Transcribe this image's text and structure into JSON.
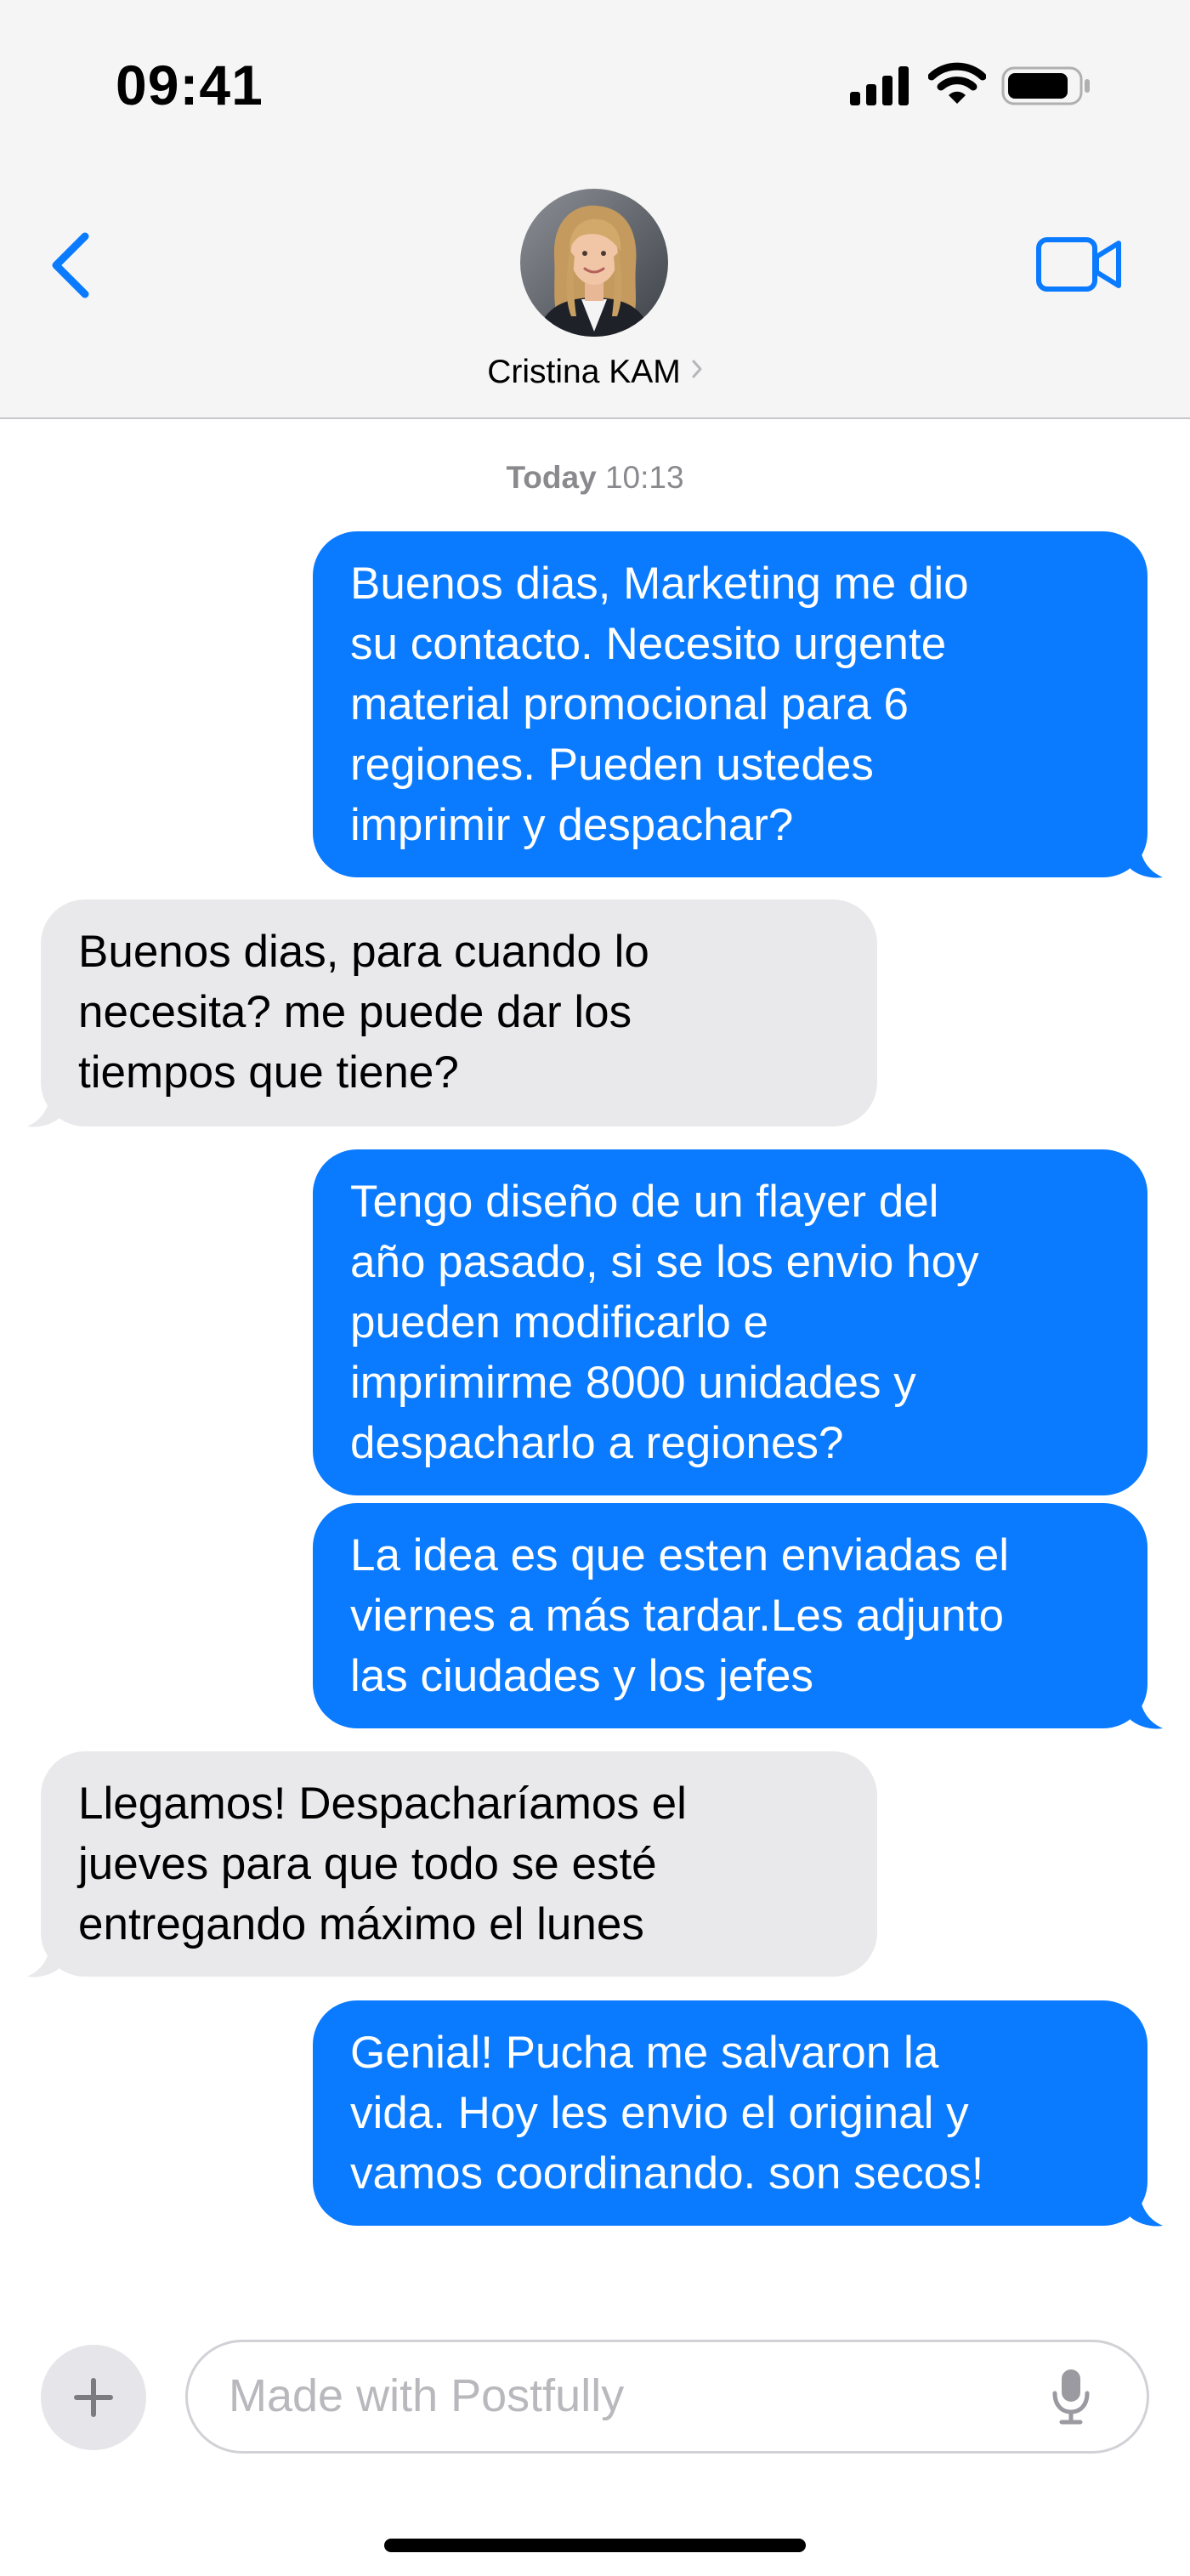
{
  "status_bar": {
    "time": "09:41"
  },
  "header": {
    "contact_name": "Cristina KAM",
    "avatar_icon": "contact-avatar-photo",
    "back_icon": "chevron-left-icon",
    "video_icon": "video-camera-icon"
  },
  "conversation": {
    "timestamp_day": "Today",
    "timestamp_time": "10:13",
    "messages": [
      {
        "direction": "outgoing",
        "text": "Buenos dias, Marketing me dio\nsu contacto. Necesito urgente\nmaterial promocional para 6\nregiones. Pueden ustedes\nimprimir y despachar?"
      },
      {
        "direction": "incoming",
        "text": "Buenos dias, para cuando lo\nnecesita? me puede dar los\ntiempos que tiene?"
      },
      {
        "direction": "outgoing",
        "text": "Tengo  diseño de un flayer del\naño pasado, si se los envio hoy\npueden modificarlo e\nimprimirme 8000 unidades y\ndespacharlo a regiones?"
      },
      {
        "direction": "outgoing",
        "text": "La idea es que esten enviadas el\nviernes a más tardar.Les adjunto\nlas ciudades y los jefes"
      },
      {
        "direction": "incoming",
        "text": "Llegamos!  Despacharíamos el\njueves para que todo se esté\nentregando máximo el lunes"
      },
      {
        "direction": "outgoing",
        "text": "Genial! Pucha me salvaron la\nvida. Hoy les envio el original y\nvamos coordinando. son secos!"
      }
    ]
  },
  "composer": {
    "placeholder": "Made with Postfully",
    "plus_icon": "plus-icon",
    "mic_icon": "microphone-icon"
  },
  "colors": {
    "outgoing_bubble": "#0a7aff",
    "incoming_bubble": "#e9e9eb",
    "accent": "#0a7aff"
  }
}
